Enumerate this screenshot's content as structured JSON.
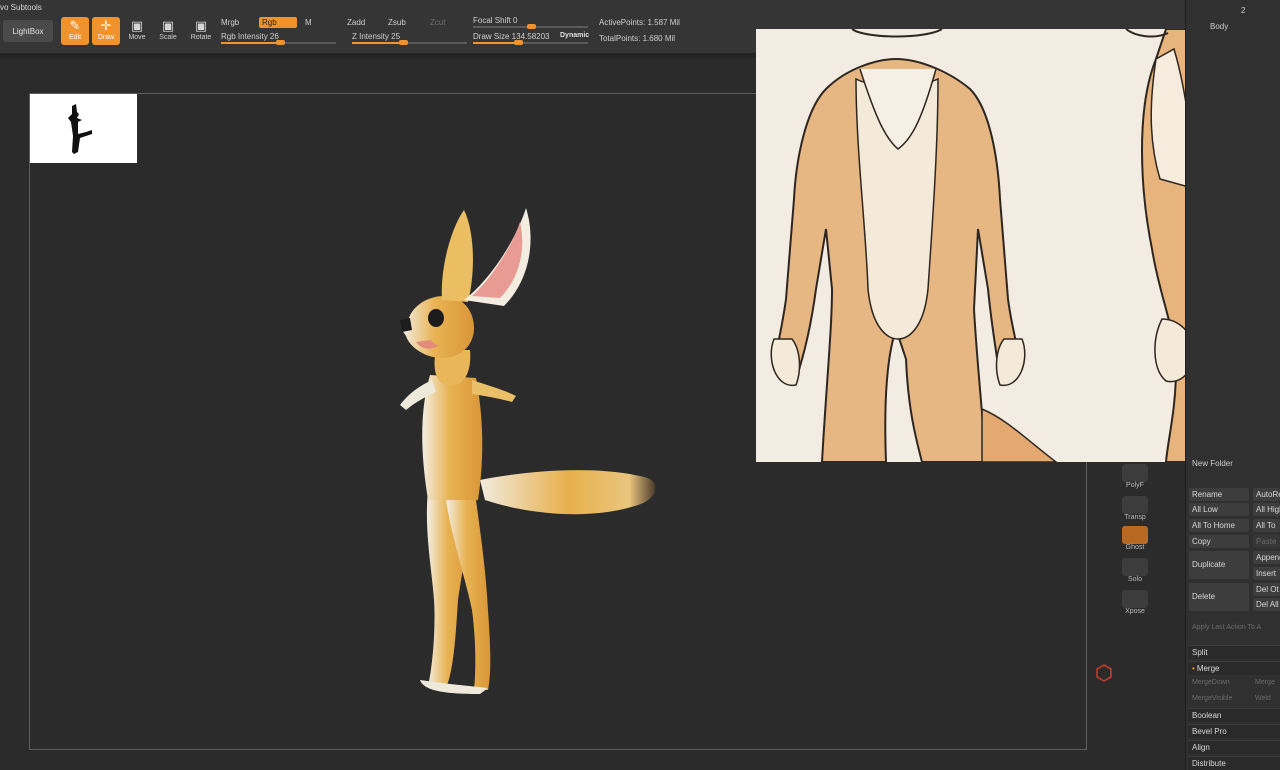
{
  "window": {
    "title": "vo Subtools"
  },
  "toolbar": {
    "lightbox": "LightBox",
    "tools": [
      {
        "label": "Edit",
        "icon": "edit-icon"
      },
      {
        "label": "Draw",
        "icon": "draw-icon"
      },
      {
        "label": "Move",
        "icon": "move-icon"
      },
      {
        "label": "Scale",
        "icon": "scale-icon"
      },
      {
        "label": "Rotate",
        "icon": "rotate-icon"
      }
    ],
    "mrgb": "Mrgb",
    "rgb": "Rgb",
    "m": "M",
    "rgb_intensity": "Rgb Intensity 26",
    "zadd": "Zadd",
    "zsub": "Zsub",
    "zcut": "Zcut",
    "z_intensity": "Z Intensity 25",
    "focal_shift": "Focal Shift 0",
    "draw_size": "Draw Size 134.58203",
    "dynamic": "Dynamic",
    "active_points": "ActivePoints: 1.587 Mil",
    "total_points": "TotalPoints: 1.680 Mil"
  },
  "right_tools": [
    {
      "label": "PolyF",
      "icon": "polyframe-icon"
    },
    {
      "label": "Transp",
      "icon": "transparency-icon"
    },
    {
      "label": "Ghost",
      "icon": "ghost-icon"
    },
    {
      "label": "Solo",
      "icon": "solo-icon"
    },
    {
      "label": "Xpose",
      "icon": "xpose-icon"
    }
  ],
  "panel": {
    "top_value": "2",
    "body_label": "Body",
    "new_folder": "New Folder",
    "buttons_left": [
      "Rename",
      "All Low",
      "All To Home",
      "Copy",
      "Duplicate",
      "Delete"
    ],
    "buttons_right": [
      "AutoRe",
      "All High",
      "All To",
      "Paste",
      "Append",
      "Insert",
      "Del Ot",
      "Del All"
    ],
    "apply_last": "Apply Last Action To A",
    "split": "Split",
    "merge": "Merge",
    "merge_down": "MergeDown",
    "merge_r": "Merge",
    "merge_visible": "MergeVisible",
    "weld": "Weld",
    "boolean": "Boolean",
    "bevel_pro": "Bevel Pro",
    "align": "Align",
    "distribute": "Distribute"
  },
  "colors": {
    "accent": "#f0922d",
    "background": "#2b2b2b",
    "toolbar": "#353535",
    "fur_orange": "#e3a848",
    "fur_cream": "#f2ece0"
  }
}
